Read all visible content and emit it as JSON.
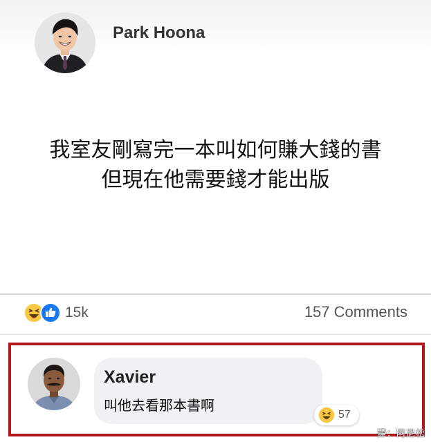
{
  "post": {
    "author": "Park Hoona",
    "avatar_icon": "profile-photo-young-man",
    "text_lines": [
      "我室友剛寫完一本叫如何賺大錢的書",
      "但現在他需要錢才能出版"
    ]
  },
  "stats": {
    "reaction_icons": [
      "haha-icon",
      "like-icon"
    ],
    "reactions_count": "15k",
    "comments_count": "157 Comments"
  },
  "comment": {
    "author": "Xavier",
    "avatar_icon": "profile-photo-mustached-man",
    "text": "叫他去看那本書啊",
    "reaction_icon": "haha-icon",
    "reaction_count": "57",
    "highlight_color": "#b3141e"
  },
  "watermark": "譯：阿尼松",
  "colors": {
    "like_blue": "#1877f2",
    "haha_yellow": "#f7c843",
    "bubble_gray": "#f0f1f3"
  }
}
